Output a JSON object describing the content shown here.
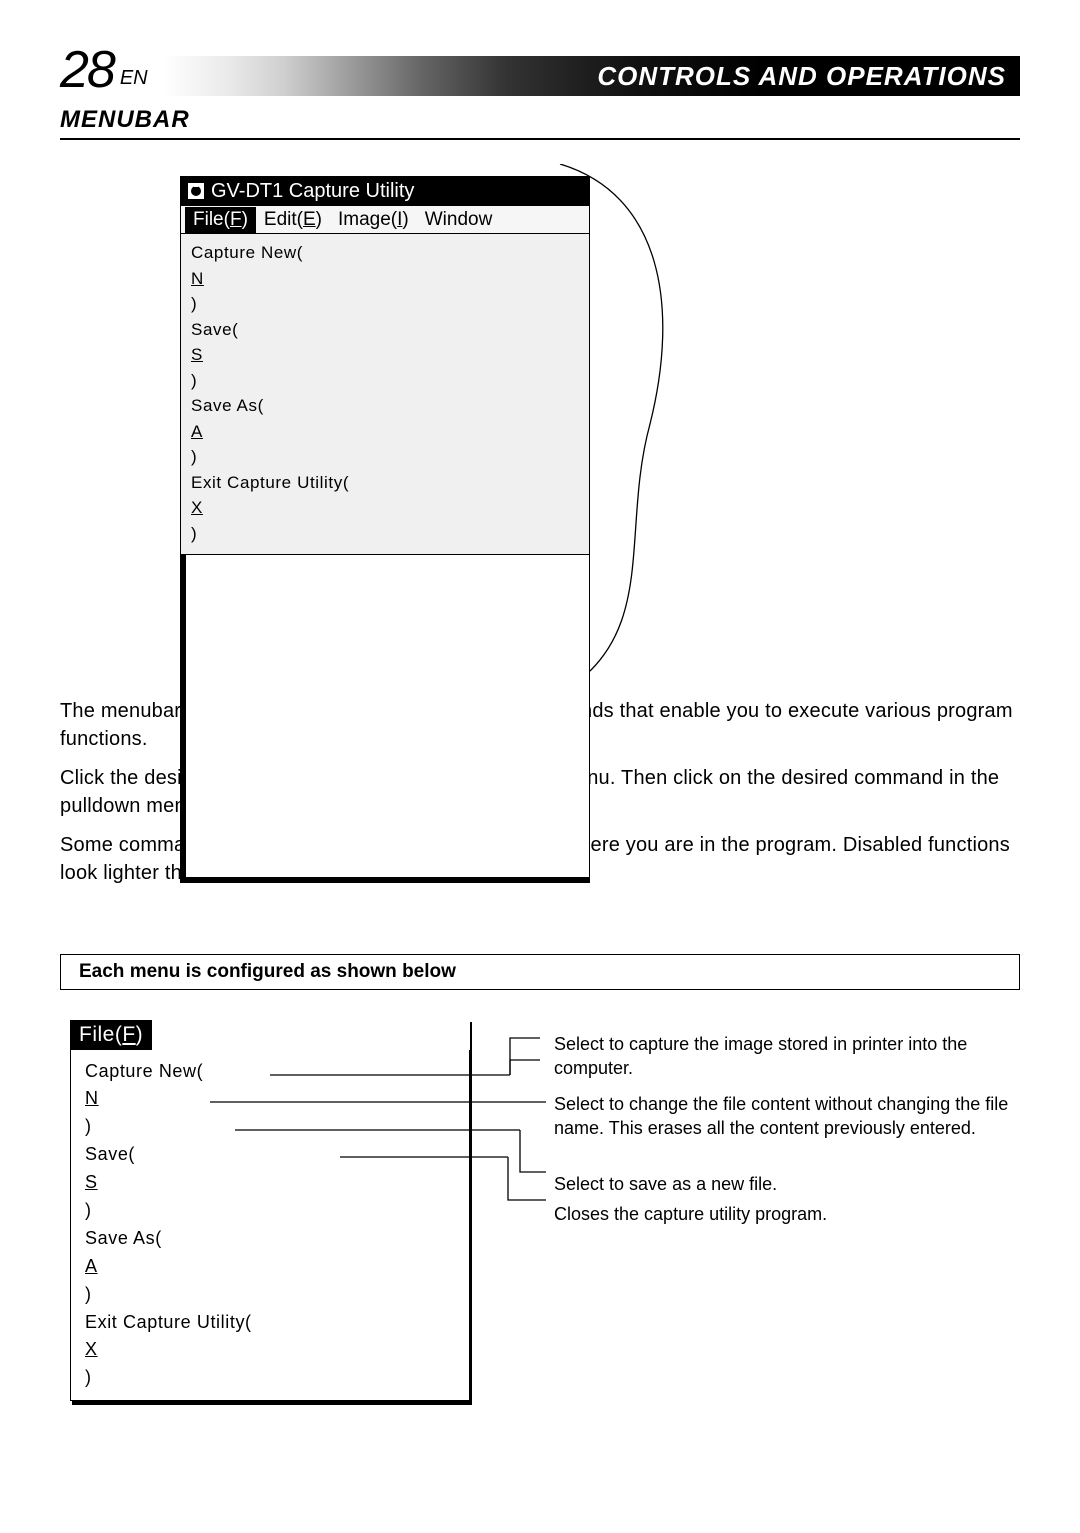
{
  "header": {
    "page_number": "28",
    "lang": "EN",
    "title": "CONTROLS AND OPERATIONS"
  },
  "section_title": "MENUBAR",
  "window": {
    "title": "GV-DT1 Capture Utility",
    "menus": {
      "file": {
        "label": "File(",
        "key": "F",
        "close": ")"
      },
      "edit": {
        "label": "Edit(",
        "key": "E",
        "close": ")"
      },
      "image": {
        "label": "Image(",
        "key": "I",
        "close": ")"
      },
      "window": {
        "label": "Window"
      }
    },
    "dropdown": {
      "i1": {
        "label": "Capture New(",
        "key": "N",
        "close": ")"
      },
      "i2": {
        "label": "Save(",
        "key": "S",
        "close": ")"
      },
      "i3": {
        "label": "Save As(",
        "key": "A",
        "close": ")"
      },
      "i4": {
        "label": "Exit Capture Utility(",
        "key": "X",
        "close": ")"
      }
    }
  },
  "body": {
    "p1": "The menubar provides several menus with lists of commands that enable you to execute various program functions.",
    "p2": "Click the desired item on the menubar to pull down the menu. Then click on the desired command in the pulldown menu.",
    "p3": "Some commands may not be executable depending on where you are in the program.  Disabled functions look lighter than other items."
  },
  "subheading": "Each menu is configured as shown below",
  "file_menu": {
    "head": {
      "label": "File(",
      "key": "F",
      "close": ")"
    },
    "items": {
      "i1": {
        "label": "Capture New(",
        "key": "N",
        "close": ")"
      },
      "i2": {
        "label": "Save(",
        "key": "S",
        "close": ")"
      },
      "i3": {
        "label": "Save As(",
        "key": "A",
        "close": ")"
      },
      "i4": {
        "label": "Exit Capture Utility(",
        "key": "X",
        "close": ")"
      }
    }
  },
  "descriptions": {
    "d1": "Select to capture the image stored in printer into the computer.",
    "d2": "Select to change the file content without changing the file name. This erases all the content previously entered.",
    "d3": "Select to save as a new file.",
    "d4": "Closes the capture utility program."
  }
}
